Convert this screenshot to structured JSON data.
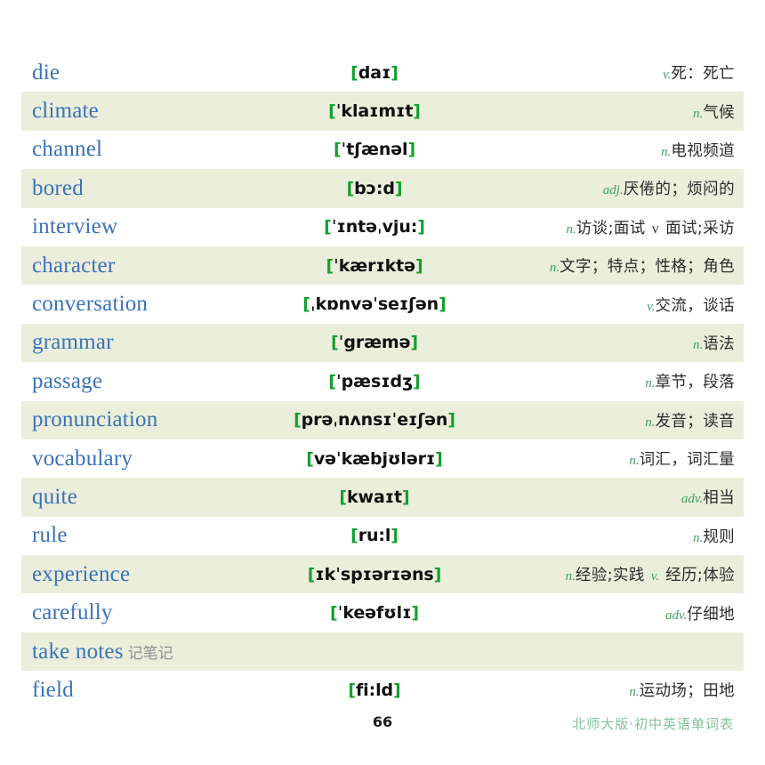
{
  "document": {
    "page_number": "66",
    "imprint": "北师大版·初中英语单词表",
    "colors": {
      "word": "#3a72b8",
      "bracket": "#12a02e",
      "part_of_speech": "#3f9e5e",
      "row_shade": "#eaeedb",
      "imprint": "#7fc49a",
      "definition": "#2b2b2b"
    }
  },
  "entries": [
    {
      "word": "die",
      "phonetic_open": "[",
      "phonetic_body": "daɪ",
      "phonetic_close": "]",
      "pos": "v.",
      "definition": "死：死亡",
      "shaded": false
    },
    {
      "word": "climate",
      "phonetic_open": "[",
      "phonetic_body": "ˈklaɪmɪt",
      "phonetic_close": "]",
      "pos": "n.",
      "definition": "气候",
      "shaded": true
    },
    {
      "word": "channel",
      "phonetic_open": "[",
      "phonetic_body": "ˈtʃænəl",
      "phonetic_close": "]",
      "pos": "n.",
      "definition": "电视频道",
      "shaded": false
    },
    {
      "word": "bored",
      "phonetic_open": "[",
      "phonetic_body": "bɔ:d",
      "phonetic_close": "]",
      "pos": "adj.",
      "definition": "厌倦的；烦闷的",
      "shaded": true
    },
    {
      "word": "interview",
      "phonetic_open": "[",
      "phonetic_body": "ˈɪntəˌvju:",
      "phonetic_close": "]",
      "pos": "n.",
      "definition": "访谈;面试",
      "pos2": "v",
      "definition2": "面试;采访",
      "pos2_plain": true,
      "shaded": false
    },
    {
      "word": "character",
      "phonetic_open": "[",
      "phonetic_body": "ˈkærɪktə",
      "phonetic_close": "]",
      "pos": "n.",
      "definition": "文字；特点；性格；角色",
      "shaded": true
    },
    {
      "word": "conversation",
      "phonetic_open": "[",
      "phonetic_body": "ˌkɒnvəˈseɪʃən",
      "phonetic_close": "]",
      "pos": "v.",
      "definition": "交流，谈话",
      "shaded": false
    },
    {
      "word": "grammar",
      "phonetic_open": "[",
      "phonetic_body": "ˈgræmə",
      "phonetic_close": "]",
      "pos": "n.",
      "definition": "语法",
      "shaded": true
    },
    {
      "word": "passage",
      "phonetic_open": "[",
      "phonetic_body": "ˈpæsɪdʒ",
      "phonetic_close": "]",
      "pos": "n.",
      "definition": "章节，段落",
      "shaded": false
    },
    {
      "word": "pronunciation",
      "phonetic_open": "[",
      "phonetic_body": "prəˌnʌnsɪˈeɪʃən",
      "phonetic_close": "]",
      "pos": "n.",
      "definition": "发音；读音",
      "shaded": true
    },
    {
      "word": "vocabulary",
      "phonetic_open": "[",
      "phonetic_body": "vəˈkæbjʊlərɪ",
      "phonetic_close": "]",
      "pos": "n.",
      "definition": "词汇，词汇量",
      "shaded": false
    },
    {
      "word": "quite",
      "phonetic_open": "[",
      "phonetic_body": "kwaɪt",
      "phonetic_close": "]",
      "pos": "adv.",
      "definition": "相当",
      "shaded": true
    },
    {
      "word": "rule",
      "phonetic_open": "[",
      "phonetic_body": "ru:l",
      "phonetic_close": "]",
      "pos": "n.",
      "definition": "规则",
      "shaded": false
    },
    {
      "word": "experience",
      "phonetic_open": "[",
      "phonetic_body": "ɪkˈspɪərɪəns",
      "phonetic_close": "]",
      "pos": "n.",
      "definition": "经验;实践",
      "pos2": "v.",
      "definition2": "经历;体验",
      "pos2_plain": false,
      "shaded": true
    },
    {
      "word": "carefully",
      "phonetic_open": "[",
      "phonetic_body": "ˈkeəfʊlɪ",
      "phonetic_close": "]",
      "pos": "adv.",
      "definition": "仔细地",
      "shaded": false
    },
    {
      "word": "take notes",
      "phrase_zh": "记笔记",
      "phonetic_open": "",
      "phonetic_body": "",
      "phonetic_close": "",
      "pos": "",
      "definition": "",
      "shaded": true
    },
    {
      "word": "field",
      "phonetic_open": "[",
      "phonetic_body": "fi:ld",
      "phonetic_close": "]",
      "pos": "n.",
      "definition": "运动场；田地",
      "shaded": false
    }
  ]
}
